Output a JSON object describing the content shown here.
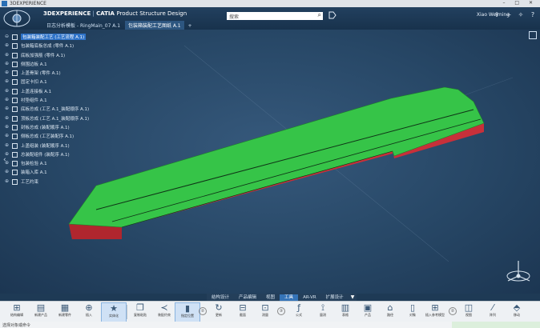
{
  "window": {
    "title": "3DEXPERIENCE",
    "controls": "– □ ✕"
  },
  "header": {
    "brand_3dx": "3DEXPERIENCE",
    "brand_sep": " | ",
    "brand_catia": "CATIA",
    "brand_app": "Product Structure Design",
    "tabs": [
      {
        "label": "日志分析模板 - RingMain_07 A.1"
      },
      {
        "label": "包装箱装配工艺图纸 A.1"
      }
    ],
    "tab_add": "+",
    "search_placeholder": "搜索",
    "user_name": "Xiao Weiming",
    "icons": [
      "share-icon",
      "add-icon",
      "compass-icon",
      "help-icon"
    ]
  },
  "tree": {
    "nodes": [
      {
        "label": "包装箱装配工艺 (工艺流程 A.1)",
        "icon": "product-icon",
        "selected": true
      },
      {
        "label": "包装箱底板总成 (零件 A.1)",
        "icon": "part-icon",
        "selected": false
      },
      {
        "label": "底板加强筋 (零件 A.1)",
        "icon": "part-icon",
        "selected": false
      },
      {
        "label": "侧围边板 A.1",
        "icon": "part-icon",
        "selected": false
      },
      {
        "label": "上盖骨架 (零件 A.1)",
        "icon": "part-icon",
        "selected": false
      },
      {
        "label": "固定卡扣 A.1",
        "icon": "part-icon",
        "selected": false
      },
      {
        "label": "上盖连接板 A.1",
        "icon": "part-icon",
        "selected": false
      },
      {
        "label": "衬垫组件 A.1",
        "icon": "part-icon",
        "selected": false
      },
      {
        "label": "底板总成 (工艺 A.1_装配顺序 A.1)",
        "icon": "process-icon",
        "selected": false
      },
      {
        "label": "顶板总成 (工艺 A.1_装配顺序 A.1)",
        "icon": "process-icon",
        "selected": false
      },
      {
        "label": "封板总成 (装配顺序 A.1)",
        "icon": "process-icon",
        "selected": false
      },
      {
        "label": "侧板总成 (工艺装配序 A.1)",
        "icon": "process-icon",
        "selected": false
      },
      {
        "label": "上盖组装 (装配顺序 A.1)",
        "icon": "process-icon",
        "selected": false
      },
      {
        "label": "总装配组件 (装配序 A.1)",
        "icon": "process-icon",
        "selected": false
      },
      {
        "label": "包装检验 A.1",
        "icon": "process-icon",
        "selected": false
      },
      {
        "label": "装箱入库 A.1",
        "icon": "process-icon",
        "selected": false
      },
      {
        "label": "工艺约束",
        "icon": "constraint-icon",
        "selected": false
      }
    ]
  },
  "section_tabs": {
    "items": [
      "结构设计",
      "产品编辑",
      "视图",
      "工具",
      "AR-VR",
      "扩展设计"
    ],
    "active_index": 3,
    "more": "▼"
  },
  "action_bar": {
    "items": [
      {
        "label": "结构编辑",
        "icon": "assembly-icon"
      },
      {
        "label": "新建产品",
        "icon": "new-product-icon"
      },
      {
        "label": "新建零件",
        "icon": "new-part-icon"
      },
      {
        "label": "插入",
        "icon": "insert-icon"
      },
      {
        "label": "实体化",
        "icon": "star-icon",
        "selected": true
      },
      {
        "label": "复制粘贴",
        "icon": "copy-icon"
      },
      {
        "label": "装配约束",
        "icon": "constraint-icon"
      },
      {
        "label": "指定位置",
        "icon": "position-icon"
      },
      {
        "label": "更新",
        "icon": "refresh-icon"
      },
      {
        "label": "截面",
        "icon": "section-icon"
      },
      {
        "label": "测量",
        "icon": "measure-icon"
      },
      {
        "label": "公式",
        "icon": "formula-icon"
      },
      {
        "label": "量测",
        "icon": "probe-icon"
      },
      {
        "label": "表格",
        "icon": "table-icon"
      },
      {
        "label": "产品",
        "icon": "product-icon"
      },
      {
        "label": "路径",
        "icon": "path-icon"
      },
      {
        "label": "对象",
        "icon": "object-icon"
      },
      {
        "label": "插入参考模型",
        "icon": "reference-icon"
      },
      {
        "label": "视图",
        "icon": "view-icon"
      },
      {
        "label": "阵列",
        "icon": "pattern-icon"
      },
      {
        "label": "移动",
        "icon": "move-icon"
      }
    ],
    "group_numbers": [
      "②",
      "③",
      "②"
    ]
  },
  "status_bar": {
    "text": "选择对象或命令"
  },
  "colors": {
    "background": "#274766",
    "model_top": "#36c448",
    "model_side": "#c8303a",
    "selection": "#2f73c8"
  }
}
